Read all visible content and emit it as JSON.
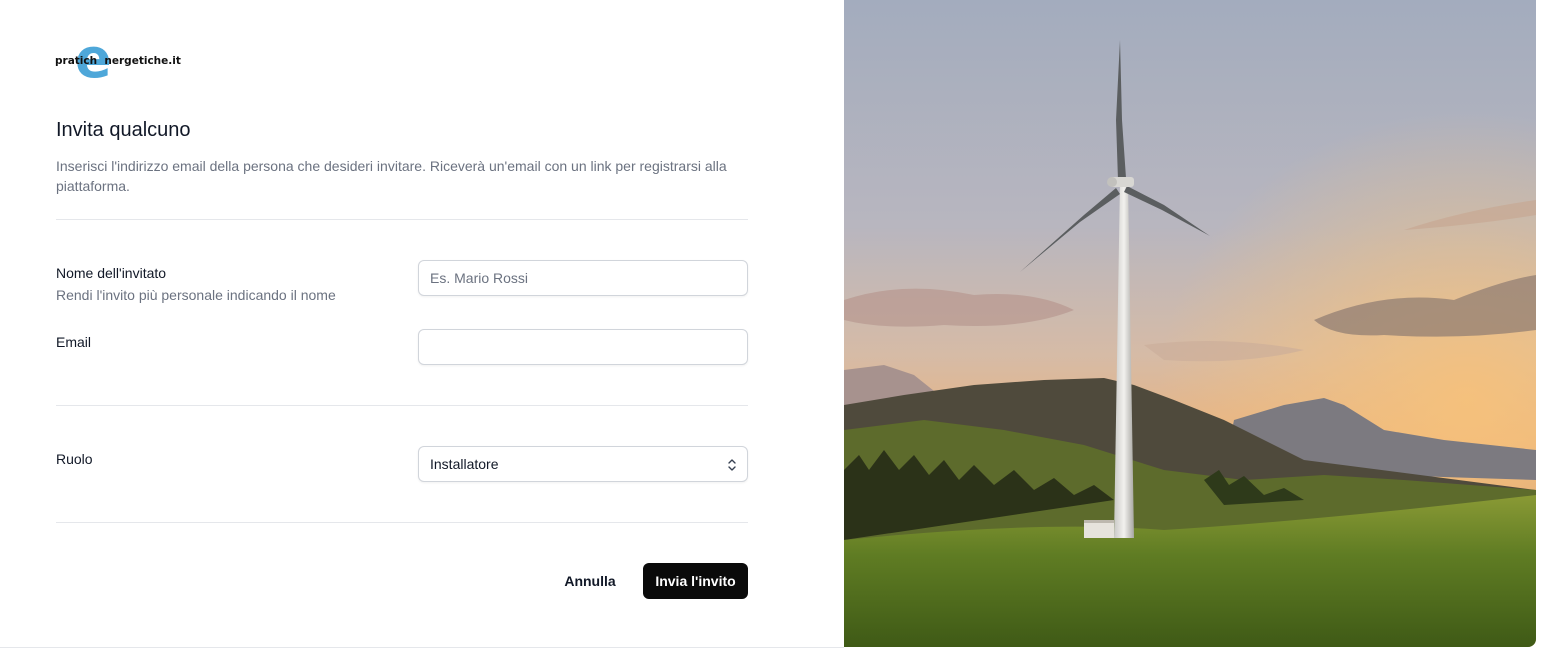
{
  "logo": {
    "letter": "e",
    "text": "pratich  nergetiche.it"
  },
  "header": {
    "title": "Invita qualcuno",
    "description": "Inserisci l'indirizzo email della persona che desideri invitare. Riceverà un'email con un link per registrarsi alla piattaforma."
  },
  "form": {
    "name_label": "Nome dell'invitato",
    "name_hint": "Rendi l'invito più personale indicando il nome",
    "name_placeholder": "Es. Mario Rossi",
    "name_value": "",
    "email_label": "Email",
    "email_value": "",
    "role_label": "Ruolo",
    "role_value": "Installatore"
  },
  "actions": {
    "cancel_label": "Annulla",
    "submit_label": "Invia l'invito"
  },
  "colors": {
    "logo_accent": "#4ea7d9",
    "primary_button": "#0a0a0a"
  },
  "hero_image": {
    "subject": "wind-turbine-landscape"
  }
}
